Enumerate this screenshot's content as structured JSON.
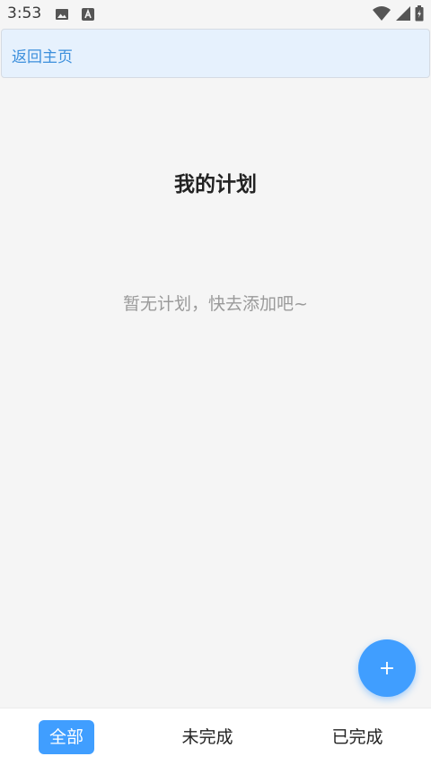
{
  "status_bar": {
    "time": "3:53",
    "icons": [
      "image-icon",
      "a-icon",
      "wifi-icon",
      "signal-icon",
      "battery-icon"
    ]
  },
  "header": {
    "back_label": "返回主页"
  },
  "main": {
    "title": "我的计划",
    "empty_text": "暂无计划，快去添加吧~"
  },
  "fab": {
    "label": "+"
  },
  "tabs": [
    {
      "label": "全部",
      "active": true
    },
    {
      "label": "未完成",
      "active": false
    },
    {
      "label": "已完成",
      "active": false
    }
  ],
  "colors": {
    "accent": "#409eff",
    "link": "#3c8fdc",
    "header_bg": "#e6f1fd",
    "page_bg": "#f5f5f5"
  }
}
